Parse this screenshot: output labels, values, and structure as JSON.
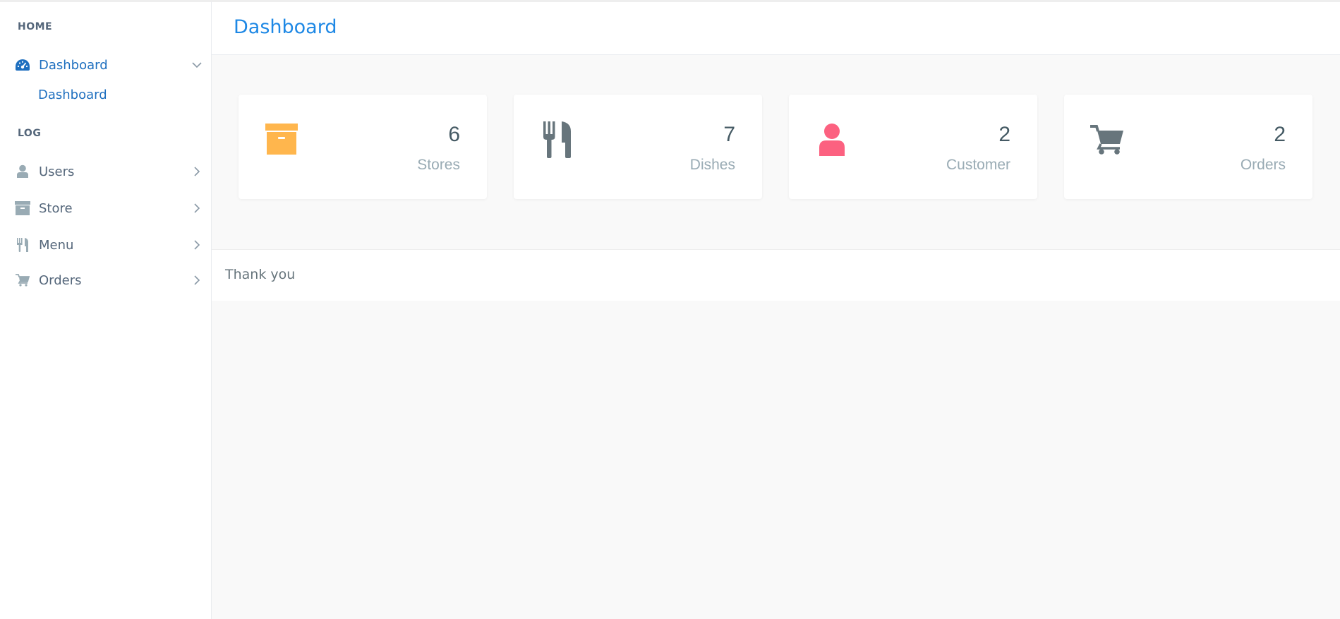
{
  "colors": {
    "accent": "#1e88e5",
    "nav_active": "#1e6fbf",
    "nav_text": "#54667a",
    "stores_icon": "#ffb64d",
    "dishes_icon": "#67757c",
    "customer_icon": "#fc6180",
    "orders_icon": "#67757c"
  },
  "sidebar": {
    "sections": [
      {
        "label": "HOME"
      },
      {
        "label": "LOG"
      }
    ],
    "items": [
      {
        "label": "Dashboard",
        "icon": "dashboard-icon",
        "active": true,
        "expanded": true
      },
      {
        "label": "Users",
        "icon": "user-icon"
      },
      {
        "label": "Store",
        "icon": "archive-icon"
      },
      {
        "label": "Menu",
        "icon": "cutlery-icon"
      },
      {
        "label": "Orders",
        "icon": "cart-icon"
      }
    ],
    "sub_items": [
      {
        "label": "Dashboard"
      }
    ]
  },
  "header": {
    "title": "Dashboard"
  },
  "stats": [
    {
      "value": "6",
      "label": "Stores",
      "icon": "archive-icon"
    },
    {
      "value": "7",
      "label": "Dishes",
      "icon": "cutlery-icon"
    },
    {
      "value": "2",
      "label": "Customer",
      "icon": "user-icon"
    },
    {
      "value": "2",
      "label": "Orders",
      "icon": "cart-icon"
    }
  ],
  "footer": {
    "text": "Thank you"
  }
}
